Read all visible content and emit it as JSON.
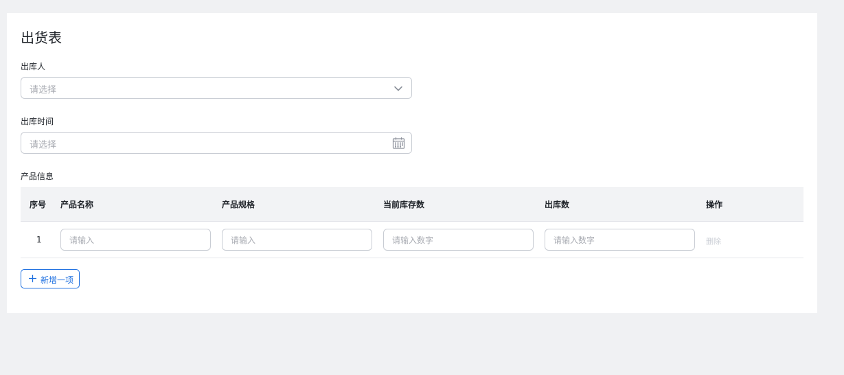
{
  "page": {
    "title": "出货表"
  },
  "form": {
    "operator": {
      "label": "出库人",
      "placeholder": "请选择",
      "icon": "chevron-down-icon"
    },
    "date": {
      "label": "出库时间",
      "placeholder": "请选择",
      "icon": "calendar-icon"
    },
    "products_label": "产品信息"
  },
  "table": {
    "columns": [
      "序号",
      "产品名称",
      "产品规格",
      "当前库存数",
      "出库数",
      "操作"
    ],
    "rows": [
      {
        "index": "1",
        "name_placeholder": "请输入",
        "spec_placeholder": "请输入",
        "stock_placeholder": "请输入数字",
        "out_placeholder": "请输入数字",
        "action": "删除"
      }
    ]
  },
  "add_button": {
    "label": "新增一项",
    "icon": "plus-icon"
  },
  "colors": {
    "background": "#f0f1f3",
    "card": "#ffffff",
    "accent": "#1d6fe0",
    "border": "#c9cdd4",
    "placeholder": "#a8abb2",
    "header_bg": "#f2f3f5"
  }
}
